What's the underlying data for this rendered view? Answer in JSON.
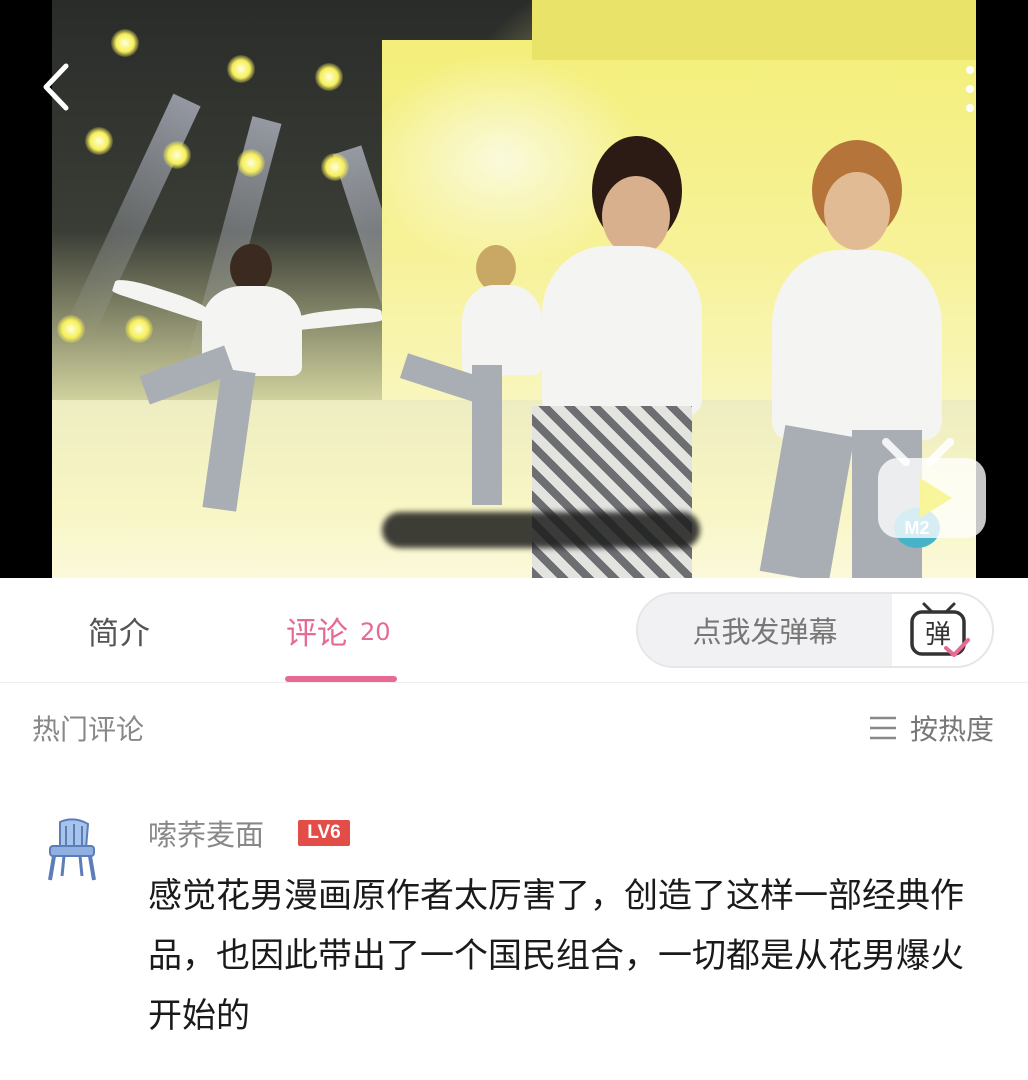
{
  "tabs": {
    "intro_label": "简介",
    "comments_label": "评论",
    "comments_count": "20"
  },
  "danmu": {
    "input_placeholder": "点我发弹幕",
    "toggle_label": "弹"
  },
  "comments_header": {
    "title": "热门评论",
    "sort_label": "按热度"
  },
  "comment": {
    "username": "嗦荞麦面",
    "level_badge": "LV6",
    "text": "感觉花男漫画原作者太厉害了，创造了这样一部经典作品，也因此带出了一个国民组合，一切都是从花男爆火开始的"
  },
  "video": {
    "channel_logo": "M2"
  },
  "icons": {
    "back": "chevron-left-icon",
    "more": "more-vertical-icon",
    "tv": "tv-play-icon",
    "danmu": "danmu-toggle-icon",
    "sort": "sort-lines-icon",
    "avatar": "plastic-chair-avatar"
  },
  "colors": {
    "accent_pink": "#e76a93",
    "level_red": "#e34d47"
  }
}
